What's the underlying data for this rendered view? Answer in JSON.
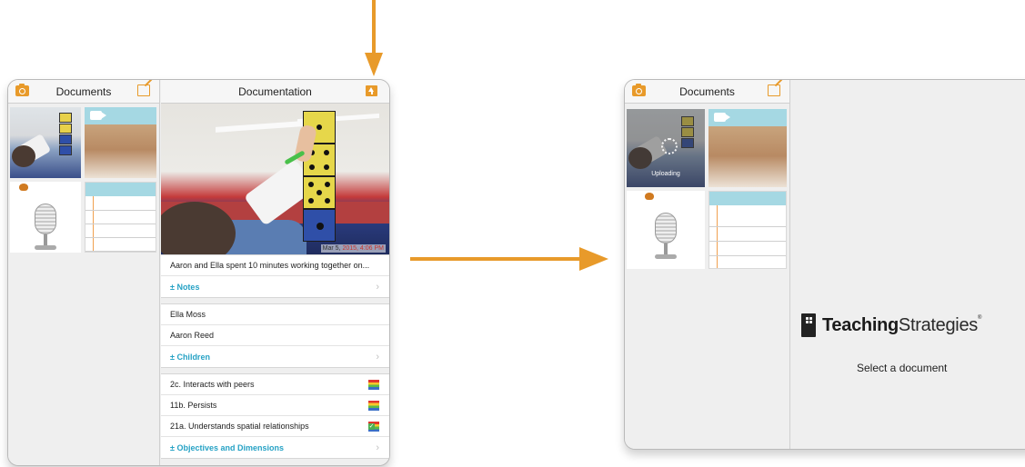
{
  "left_tablet": {
    "sidebar": {
      "title": "Documents",
      "icons": [
        "camera-icon",
        "compose-icon"
      ]
    },
    "detail": {
      "title": "Documentation",
      "header_icon": "upload-icon",
      "photo_timestamp_date": "Mar 5, ",
      "photo_timestamp_time": "2015, 4:06 PM",
      "note_text": "Aaron and Ella spent 10 minutes working together on...",
      "notes_link": "± Notes",
      "children": [
        "Ella Moss",
        "Aaron Reed"
      ],
      "children_link": "± Children",
      "objectives": [
        "2c. Interacts with peers",
        "11b. Persists",
        "21a. Understands spatial relationships"
      ],
      "objectives_link": "± Objectives and Dimensions"
    }
  },
  "right_tablet": {
    "sidebar": {
      "title": "Documents",
      "uploading_label": "Uploading"
    },
    "main": {
      "logo_bold": "Teaching",
      "logo_light": "Strategies",
      "logo_mark": "®",
      "empty_state": "Select a document"
    }
  },
  "colors": {
    "accent_orange": "#e89a2a",
    "link_blue": "#26a2c5",
    "video_bar": "#a5d8e3"
  }
}
